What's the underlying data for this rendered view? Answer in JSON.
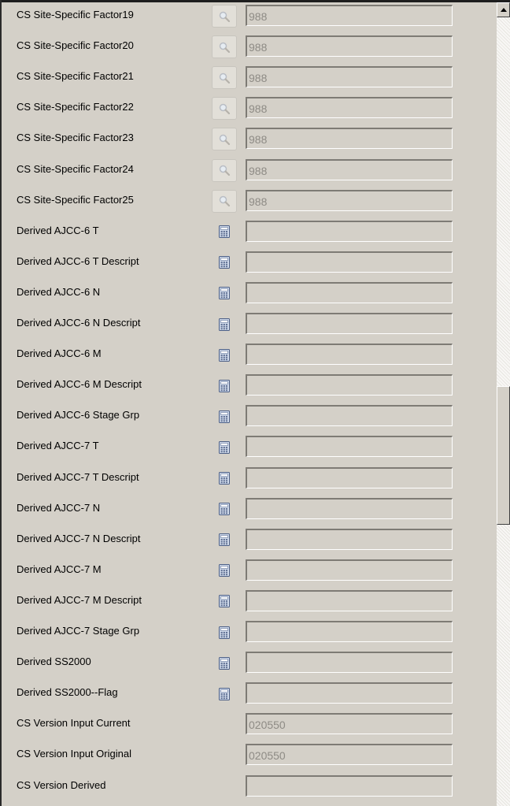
{
  "icons": {
    "lookup": "magnifier-icon",
    "calculate": "calculator-icon"
  },
  "fields": [
    {
      "label": "CS Site-Specific Factor19",
      "value": "988",
      "button": "lookup"
    },
    {
      "label": "CS Site-Specific Factor20",
      "value": "988",
      "button": "lookup"
    },
    {
      "label": "CS Site-Specific Factor21",
      "value": "988",
      "button": "lookup"
    },
    {
      "label": "CS Site-Specific Factor22",
      "value": "988",
      "button": "lookup"
    },
    {
      "label": "CS Site-Specific Factor23",
      "value": "988",
      "button": "lookup"
    },
    {
      "label": "CS Site-Specific Factor24",
      "value": "988",
      "button": "lookup"
    },
    {
      "label": "CS Site-Specific Factor25",
      "value": "988",
      "button": "lookup"
    },
    {
      "label": "Derived AJCC-6 T",
      "value": "",
      "button": "calculate"
    },
    {
      "label": "Derived AJCC-6 T Descript",
      "value": "",
      "button": "calculate"
    },
    {
      "label": "Derived AJCC-6 N",
      "value": "",
      "button": "calculate"
    },
    {
      "label": "Derived AJCC-6 N Descript",
      "value": "",
      "button": "calculate"
    },
    {
      "label": "Derived AJCC-6 M",
      "value": "",
      "button": "calculate"
    },
    {
      "label": "Derived AJCC-6 M Descript",
      "value": "",
      "button": "calculate"
    },
    {
      "label": "Derived AJCC-6 Stage Grp",
      "value": "",
      "button": "calculate"
    },
    {
      "label": "Derived AJCC-7 T",
      "value": "",
      "button": "calculate"
    },
    {
      "label": "Derived AJCC-7 T Descript",
      "value": "",
      "button": "calculate"
    },
    {
      "label": "Derived AJCC-7 N",
      "value": "",
      "button": "calculate"
    },
    {
      "label": "Derived AJCC-7 N Descript",
      "value": "",
      "button": "calculate"
    },
    {
      "label": "Derived AJCC-7 M",
      "value": "",
      "button": "calculate"
    },
    {
      "label": "Derived AJCC-7 M Descript",
      "value": "",
      "button": "calculate"
    },
    {
      "label": "Derived AJCC-7 Stage Grp",
      "value": "",
      "button": "calculate"
    },
    {
      "label": "Derived SS2000",
      "value": "",
      "button": "calculate"
    },
    {
      "label": "Derived SS2000--Flag",
      "value": "",
      "button": "calculate"
    },
    {
      "label": "CS Version Input Current",
      "value": "020550",
      "button": "none"
    },
    {
      "label": "CS Version Input Original",
      "value": "020550",
      "button": "none"
    },
    {
      "label": "CS Version Derived",
      "value": "",
      "button": "none"
    }
  ]
}
